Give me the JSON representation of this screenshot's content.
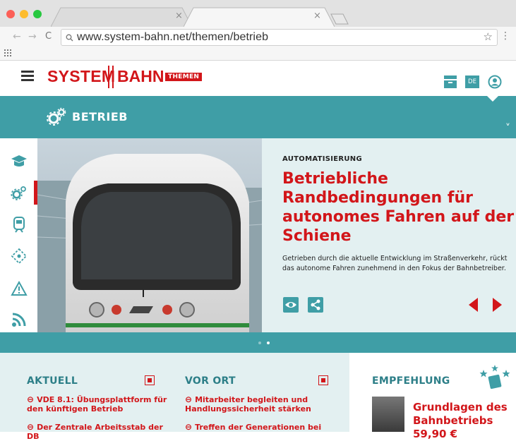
{
  "browser": {
    "url": "www.system-bahn.net/themen/betrieb",
    "tab_close": "×",
    "tab2_close": "×",
    "star": "☆",
    "menu": "⋮",
    "back": "←",
    "forward": "→",
    "reload": "C"
  },
  "site": {
    "logo_left": "SYSTEM",
    "logo_right": "BAHN",
    "logo_badge": "THEMEN",
    "lang": "DE"
  },
  "section": {
    "title": "BETRIEB",
    "chevron": "˅"
  },
  "hero": {
    "kicker": "AUTOMATISIERUNG",
    "headline": "Betriebliche Randbedingungen für autonomes Fahren auf der Schiene",
    "teaser": "Getrieben durch die aktuelle Entwicklung im Straßenverkehr, rückt das autonome Fahren zunehmend in den Fokus der Bahnbetreiber."
  },
  "aktuell": {
    "title": "AKTUELL",
    "links": [
      "VDE 8.1: Übungsplattform für den künftigen Betrieb",
      "Der Zentrale Arbeitsstab der DB"
    ]
  },
  "vor_ort": {
    "title": "VOR ORT",
    "links": [
      "Mitarbeiter begleiten und Handlungssicherheit stärken",
      "Treffen der Generationen bei"
    ]
  },
  "empfehlung": {
    "title": "EMPFEHLUNG",
    "book_title": "Grundlagen des Bahnbetriebs",
    "price": "59,90 €"
  },
  "colors": {
    "accent_red": "#d2161a",
    "teal": "#3f9ea6",
    "light_teal": "#e3f0f1"
  }
}
